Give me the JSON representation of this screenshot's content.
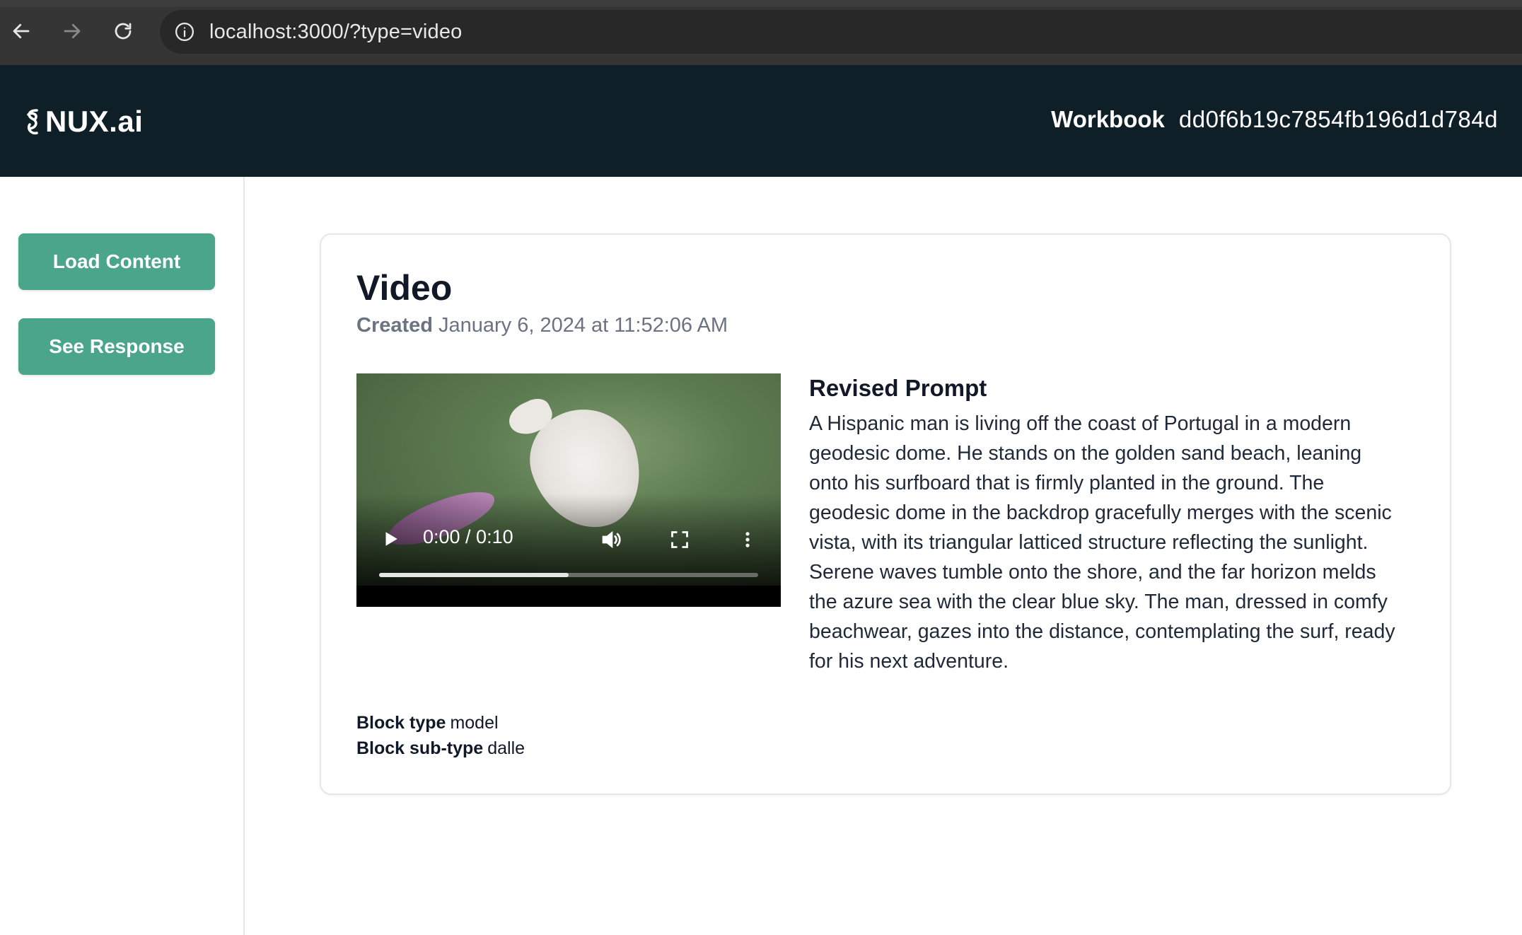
{
  "browser": {
    "url": "localhost:3000/?type=video"
  },
  "header": {
    "logo_text": "NUX.ai",
    "workbook_label": "Workbook",
    "workbook_id": "dd0f6b19c7854fb196d1d784d"
  },
  "sidebar": {
    "load_content_label": "Load Content",
    "see_response_label": "See Response"
  },
  "card": {
    "title": "Video",
    "created_label": "Created",
    "created_value": "January 6, 2024 at 11:52:06 AM",
    "video": {
      "time_display": "0:00 / 0:10",
      "progress_fraction": 0.5
    },
    "revised_prompt_title": "Revised Prompt",
    "revised_prompt_text": "A Hispanic man is living off the coast of Portugal in a modern geodesic dome. He stands on the golden sand beach, leaning onto his surfboard that is firmly planted in the ground. The geodesic dome in the backdrop gracefully merges with the scenic vista, with its triangular latticed structure reflecting the sunlight. Serene waves tumble onto the shore, and the far horizon melds the azure sea with the clear blue sky. The man, dressed in comfy beachwear, gazes into the distance, contemplating the surf, ready for his next adventure.",
    "block_type_label": "Block type",
    "block_type_value": "model",
    "block_subtype_label": "Block sub-type",
    "block_subtype_value": "dalle"
  },
  "colors": {
    "header_bg": "#0f1f27",
    "button_bg": "#4aa58a",
    "browser_bg": "#353535"
  }
}
